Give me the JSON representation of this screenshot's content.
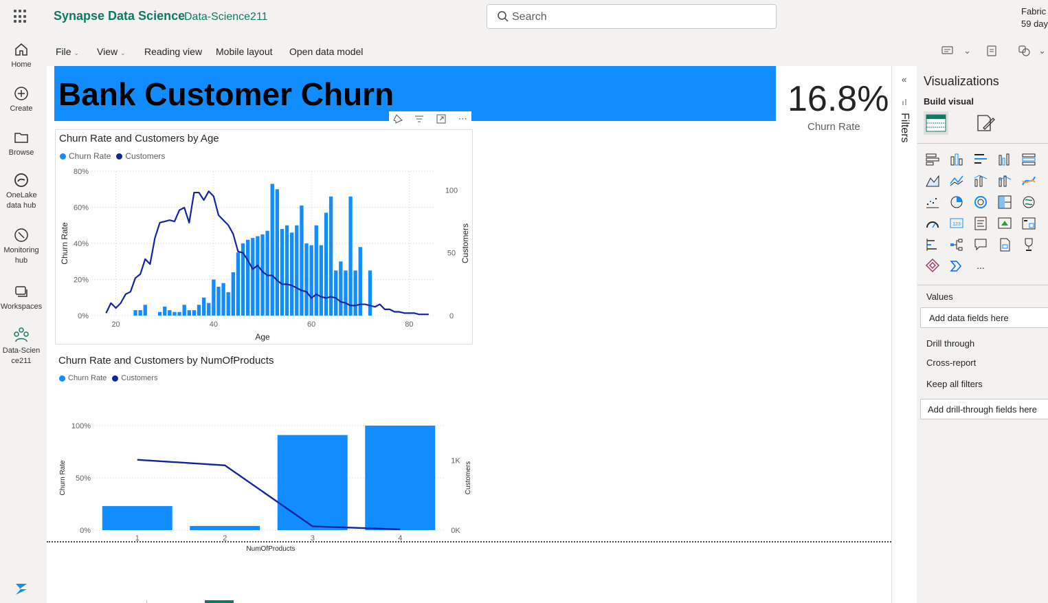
{
  "topbar": {
    "app_name": "Synapse Data Science",
    "workspace": "Data-Science211",
    "search_placeholder": "Search",
    "trial_line1": "Fabric",
    "trial_line2": "59 day"
  },
  "nav": [
    {
      "label": "Home",
      "icon": "home-icon"
    },
    {
      "label": "Create",
      "icon": "plus-circle-icon"
    },
    {
      "label": "Browse",
      "icon": "folder-icon"
    },
    {
      "label": "OneLake data hub",
      "icon": "onelake-icon"
    },
    {
      "label": "Monitoring hub",
      "icon": "monitor-icon"
    },
    {
      "label": "Workspaces",
      "icon": "workspaces-icon"
    },
    {
      "label": "Data-Science211",
      "icon": "workspace-people-icon"
    }
  ],
  "toolbar": {
    "file": "File",
    "view": "View",
    "reading_view": "Reading view",
    "mobile_layout": "Mobile layout",
    "open_data_model": "Open data model"
  },
  "report": {
    "title": "Bank Customer Churn",
    "kpi_value": "16.8%",
    "kpi_label": "Churn Rate"
  },
  "filters": {
    "label": "Filters"
  },
  "visualizations": {
    "title": "Visualizations",
    "build_visual": "Build visual",
    "values_label": "Values",
    "values_placeholder": "Add data fields here",
    "drill_through": "Drill through",
    "cross_report": "Cross-report",
    "keep_all_filters": "Keep all filters",
    "drill_placeholder": "Add drill-through fields here",
    "more": "..."
  },
  "colors": {
    "bar": "#118dff",
    "line": "#12239e",
    "brand": "#117865"
  },
  "chart_data": [
    {
      "type": "bar",
      "title": "Churn Rate and Customers by Age",
      "xlabel": "Age",
      "ylabel": "Churn Rate",
      "y2label": "Customers",
      "legend": [
        "Churn Rate",
        "Customers"
      ],
      "x_ticks": [
        "20",
        "40",
        "60",
        "80"
      ],
      "y_ticks": [
        "0%",
        "20%",
        "40%",
        "60%",
        "80%"
      ],
      "y2_ticks": [
        "0",
        "50",
        "100"
      ],
      "xlim": [
        15,
        85
      ],
      "ylim": [
        0,
        0.8
      ],
      "y2lim": [
        0,
        115
      ],
      "series": [
        {
          "name": "Churn Rate",
          "kind": "bar",
          "axis": "left",
          "x": [
            24,
            25,
            26,
            27,
            29,
            30,
            31,
            32,
            33,
            34,
            35,
            36,
            37,
            38,
            39,
            40,
            41,
            42,
            43,
            44,
            45,
            46,
            47,
            48,
            49,
            50,
            51,
            52,
            53,
            54,
            55,
            56,
            57,
            58,
            59,
            60,
            61,
            62,
            63,
            64,
            65,
            66,
            67,
            68,
            69,
            70,
            71,
            72,
            73
          ],
          "values": [
            0.03,
            0.03,
            0.06,
            0.0,
            0.02,
            0.05,
            0.03,
            0.02,
            0.02,
            0.06,
            0.03,
            0.03,
            0.06,
            0.1,
            0.07,
            0.2,
            0.16,
            0.18,
            0.13,
            0.24,
            0.35,
            0.4,
            0.42,
            0.43,
            0.44,
            0.45,
            0.47,
            0.73,
            0.7,
            0.48,
            0.5,
            0.46,
            0.5,
            0.61,
            0.4,
            0.39,
            0.5,
            0.39,
            0.57,
            0.66,
            0.25,
            0.3,
            0.25,
            0.66,
            0.25,
            0.38,
            0.0,
            0.25,
            0.0
          ]
        },
        {
          "name": "Customers",
          "kind": "line",
          "axis": "right",
          "x": [
            18,
            19,
            20,
            21,
            22,
            23,
            24,
            25,
            26,
            27,
            28,
            29,
            30,
            31,
            32,
            33,
            34,
            35,
            36,
            37,
            38,
            39,
            40,
            41,
            42,
            43,
            44,
            45,
            46,
            47,
            48,
            49,
            50,
            51,
            52,
            53,
            54,
            55,
            56,
            57,
            58,
            59,
            60,
            61,
            62,
            63,
            64,
            65,
            66,
            67,
            68,
            69,
            70,
            71,
            72,
            73,
            74,
            75,
            76,
            77,
            78,
            79,
            80,
            81,
            82,
            84
          ],
          "values": [
            2,
            10,
            6,
            10,
            17,
            19,
            30,
            33,
            45,
            41,
            62,
            74,
            75,
            76,
            75,
            84,
            86,
            74,
            98,
            98,
            92,
            99,
            95,
            80,
            76,
            72,
            65,
            51,
            50,
            44,
            37,
            40,
            35,
            32,
            32,
            28,
            25,
            25,
            24,
            22,
            20,
            19,
            14,
            17,
            15,
            14,
            15,
            14,
            11,
            10,
            8,
            8,
            9,
            9,
            8,
            7,
            9,
            5,
            5,
            3,
            3,
            2,
            2,
            2,
            1,
            1
          ]
        }
      ]
    },
    {
      "type": "bar",
      "title": "Churn Rate and Customers by NumOfProducts",
      "xlabel": "NumOfProducts",
      "ylabel": "Churn Rate",
      "y2label": "Customers",
      "legend": [
        "Churn Rate",
        "Customers"
      ],
      "categories": [
        "1",
        "2",
        "3",
        "4"
      ],
      "y_ticks": [
        "0%",
        "50%",
        "100%"
      ],
      "y2_ticks": [
        "0K",
        "1K"
      ],
      "ylim": [
        0,
        1.0
      ],
      "y2lim": [
        0,
        1500
      ],
      "series": [
        {
          "name": "Churn Rate",
          "kind": "bar",
          "axis": "left",
          "values": [
            0.23,
            0.04,
            0.91,
            1.0
          ]
        },
        {
          "name": "Customers",
          "kind": "line",
          "axis": "right",
          "values": [
            1010,
            930,
            55,
            10
          ]
        }
      ]
    }
  ]
}
